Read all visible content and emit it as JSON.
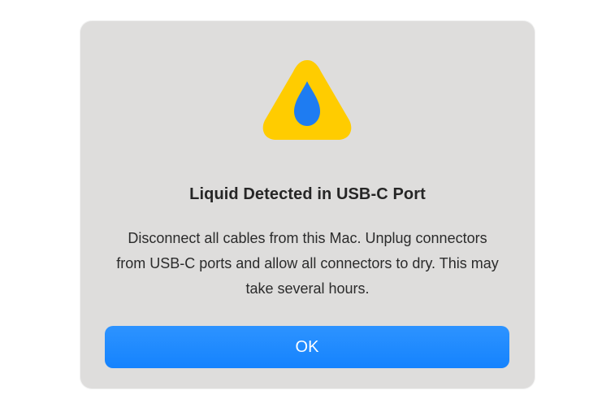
{
  "dialog": {
    "title": "Liquid Detected in USB-C Port",
    "message": "Disconnect all cables from this Mac. Unplug connectors from USB-C ports and allow all connectors to dry. This may take several hours.",
    "ok_label": "OK",
    "icon": "water-warning-icon"
  },
  "colors": {
    "dialog_background": "#dedddc",
    "warning_yellow": "#ffcc00",
    "drop_blue": "#1e7cf2",
    "button_blue": "#1583fe",
    "button_text": "#ffffff"
  }
}
